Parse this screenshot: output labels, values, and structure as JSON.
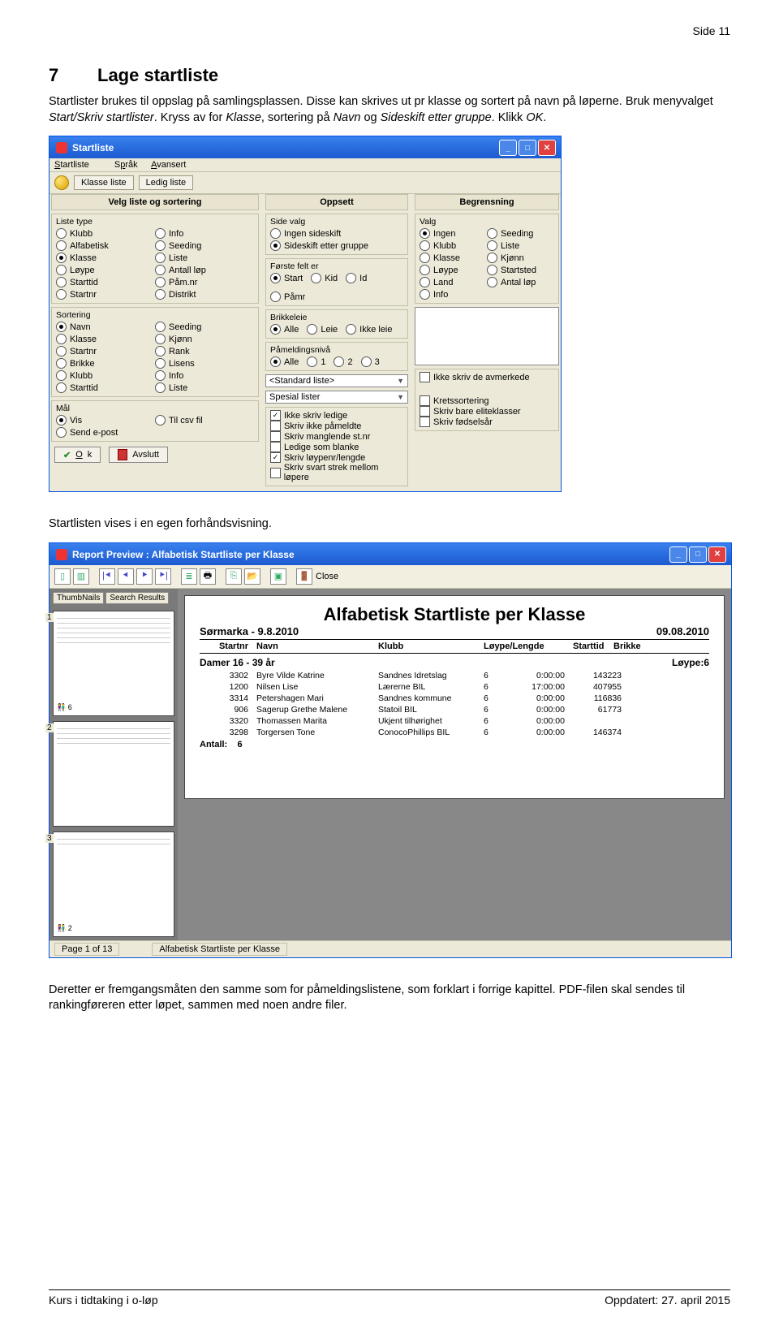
{
  "page_number": "Side 11",
  "section_number": "7",
  "section_title": "Lage startliste",
  "intro_1": "Startlister brukes til oppslag på samlingsplassen. Disse kan skrives ut pr klasse og sortert på navn på løperne. Bruk menyvalget ",
  "intro_menu": "Start/Skriv startlister",
  "intro_2": ". Kryss av for ",
  "intro_klasse": "Klasse",
  "intro_3": ", sortering på ",
  "intro_navn": "Navn",
  "intro_4": " og ",
  "intro_sideskift": "Sideskift etter gruppe",
  "intro_5": ". Klikk ",
  "intro_ok": "OK",
  "intro_6": ".",
  "after_screenshot1": "Startlisten vises i en egen forhåndsvisning.",
  "after_screenshot2": "Deretter er fremgangsmåten den samme som for påmeldingslistene, som forklart i forrige kapittel. PDF-filen skal sendes til rankingføreren etter løpet, sammen med noen andre filer.",
  "footer_left": "Kurs i tidtaking i o-løp",
  "footer_right": "Oppdatert: 27. april 2015",
  "win1": {
    "title": "Startliste",
    "menu": {
      "m1": "Startliste",
      "m2": "Språk",
      "m3": "Avansert"
    },
    "tabs": {
      "t1": "Klasse liste",
      "t2": "Ledig liste"
    },
    "col1_header": "Velg liste og sortering",
    "col2_header": "Oppsett",
    "col3_header": "Begrensning",
    "listetype_label": "Liste type",
    "listetype": [
      "Klubb",
      "Alfabetisk",
      "Klasse",
      "Løype",
      "Starttid",
      "Startnr",
      "Info",
      "Seeding",
      "Liste",
      "Antall løp",
      "Påm.nr",
      "Distrikt"
    ],
    "listetype_selected": "Klasse",
    "sortering_label": "Sortering",
    "sortering": [
      "Navn",
      "Klasse",
      "Startnr",
      "Brikke",
      "Klubb",
      "Starttid",
      "Seeding",
      "Kjønn",
      "Rank",
      "Lisens",
      "Info",
      "Liste"
    ],
    "sortering_selected": "Navn",
    "mal_label": "Mål",
    "mal": [
      "Vis",
      "Send e-post",
      "Til csv fil"
    ],
    "mal_selected": "Vis",
    "sidevalg_label": "Side valg",
    "sidevalg": [
      "Ingen sideskift",
      "Sideskift etter gruppe"
    ],
    "sidevalg_selected": "Sideskift etter gruppe",
    "forstefelt_label": "Første felt er",
    "forstefelt": [
      "Start",
      "Kid",
      "Id",
      "Påmr"
    ],
    "forstefelt_selected": "Start",
    "brikkeleie_label": "Brikkeleie",
    "brikkeleie": [
      "Alle",
      "Leie",
      "Ikke leie"
    ],
    "brikkeleie_selected": "Alle",
    "pameld_label": "Påmeldingsnivå",
    "pameld": [
      "Alle",
      "1",
      "2",
      "3"
    ],
    "pameld_selected": "Alle",
    "std_select": "<Standard liste>",
    "spesial_select": "Spesial lister",
    "check_opts": [
      "Ikke skriv ledige",
      "Skriv ikke påmeldte",
      "Skriv manglende st.nr",
      "Ledige som blanke",
      "Skriv løypenr/lengde",
      "Skriv svart strek mellom løpere"
    ],
    "check_opts_sel": [
      true,
      false,
      false,
      false,
      true,
      false
    ],
    "valg_label": "Valg",
    "valg": [
      "Ingen",
      "Klubb",
      "Klasse",
      "Løype",
      "Land",
      "Info",
      "Seeding",
      "Liste",
      "Kjønn",
      "Startsted",
      "Antal løp"
    ],
    "valg_selected": "Ingen",
    "right_checks": [
      "Ikke skriv de avmerkede",
      "Kretssortering",
      "Skriv bare eliteklasser",
      "Skriv fødselsår"
    ],
    "btn_ok": "Ok",
    "btn_avslutt": "Avslutt"
  },
  "win2": {
    "title": "Report Preview : Alfabetisk Startliste per Klasse",
    "btn_close": "Close",
    "thumb_tab1": "ThumbNails",
    "thumb_tab2": "Search Results",
    "thumb_small_count": "6",
    "thumb3_small": "2",
    "status_page": "Page 1 of 13",
    "status_title": "Alfabetisk Startliste per Klasse",
    "page_title": "Alfabetisk Startliste per Klasse",
    "event": "Sørmarka - 9.8.2010",
    "date": "09.08.2010",
    "head": {
      "c1": "Startnr",
      "c2": "Navn",
      "c3": "Klubb",
      "c4": "Løype/Lengde",
      "c5": "Starttid",
      "c6": "Brikke"
    },
    "class_name": "Damer 16 - 39 år",
    "class_loype": "Løype:6",
    "rows": [
      {
        "startnr": "3302",
        "navn": "Byre Vilde Katrine",
        "klubb": "Sandnes Idretslag",
        "loype": "6",
        "starttid": "0:00:00",
        "brikke": "143223"
      },
      {
        "startnr": "1200",
        "navn": "Nilsen Lise",
        "klubb": "Lærerne BIL",
        "loype": "6",
        "starttid": "17:00:00",
        "brikke": "407955"
      },
      {
        "startnr": "3314",
        "navn": "Petershagen Mari",
        "klubb": "Sandnes kommune",
        "loype": "6",
        "starttid": "0:00:00",
        "brikke": "116836"
      },
      {
        "startnr": "906",
        "navn": "Sagerup Grethe Malene",
        "klubb": "Statoil BIL",
        "loype": "6",
        "starttid": "0:00:00",
        "brikke": "61773"
      },
      {
        "startnr": "3320",
        "navn": "Thomassen Marita",
        "klubb": "Ukjent tilhørighet",
        "loype": "6",
        "starttid": "0:00:00",
        "brikke": ""
      },
      {
        "startnr": "3298",
        "navn": "Torgersen Tone",
        "klubb": "ConocoPhillips BIL",
        "loype": "6",
        "starttid": "0:00:00",
        "brikke": "146374"
      }
    ],
    "antall_label": "Antall:",
    "antall": "6"
  }
}
